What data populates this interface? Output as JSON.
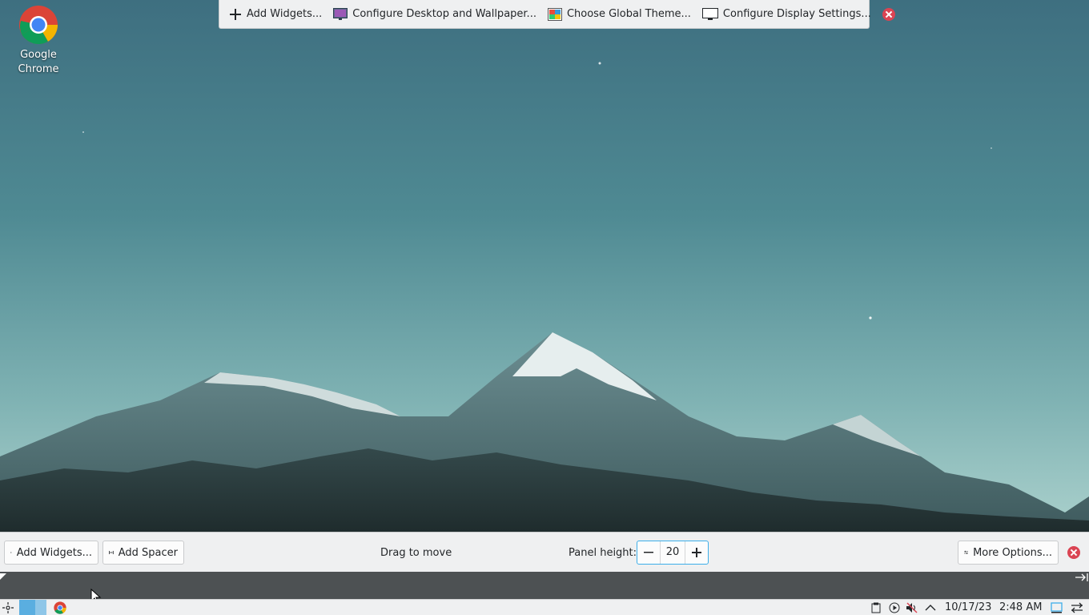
{
  "desktop": {
    "icons": [
      {
        "label_line1": "Google",
        "label_line2": "Chrome",
        "icon": "chrome-icon"
      }
    ]
  },
  "top_toolbar": {
    "add_widgets": "Add Widgets...",
    "configure_desktop": "Configure Desktop and Wallpaper...",
    "choose_theme": "Choose Global Theme...",
    "configure_display": "Configure Display Settings...",
    "close_icon": "close-icon"
  },
  "panel_edit": {
    "add_widgets": "Add Widgets...",
    "add_spacer": "Add Spacer",
    "drag_to_move": "Drag to move",
    "panel_height_label": "Panel height:",
    "panel_height_value": "20",
    "more_options": "More Options..."
  },
  "taskbar": {
    "date": "10/17/23",
    "time": "2:48 AM"
  },
  "colors": {
    "accent": "#3daee9",
    "close_red": "#da4453",
    "panel_bg": "#eff0f1",
    "ruler_bg": "#4d5153"
  }
}
